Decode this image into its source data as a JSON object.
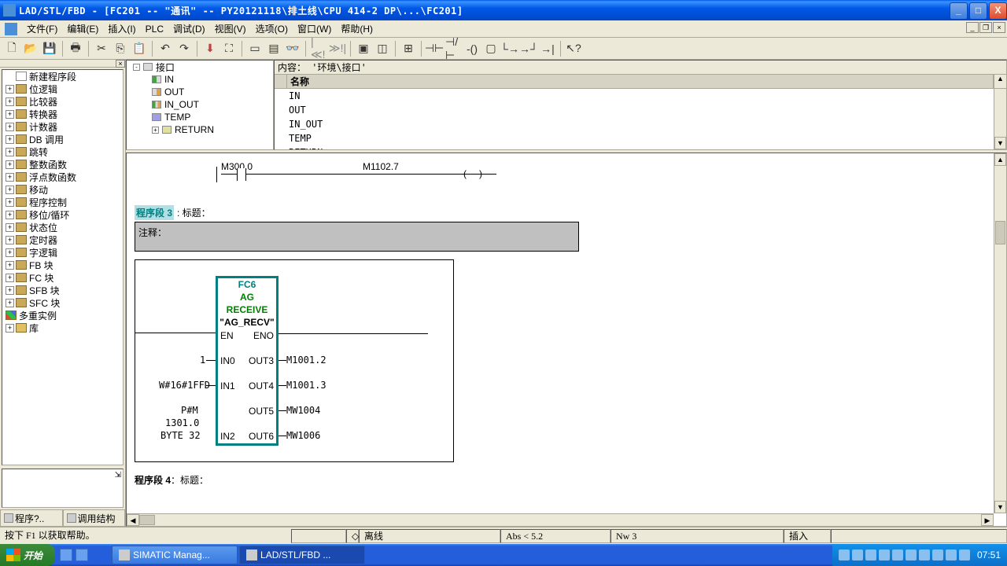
{
  "titlebar": {
    "title": "LAD/STL/FBD  - [FC201 -- \"通讯\" -- PY20121118\\排土线\\CPU 414-2 DP\\...\\FC201]"
  },
  "menu": {
    "file": "文件(F)",
    "edit": "编辑(E)",
    "insert": "插入(I)",
    "plc": "PLC",
    "debug": "调试(D)",
    "view": "视图(V)",
    "options": "选项(O)",
    "window": "窗口(W)",
    "help": "帮助(H)"
  },
  "sidebar": {
    "catalog": [
      "新建程序段",
      "位逻辑",
      "比较器",
      "转换器",
      "计数器",
      "DB 调用",
      "跳转",
      "整数函数",
      "浮点数函数",
      "移动",
      "程序控制",
      "移位/循环",
      "状态位",
      "定时器",
      "字逻辑",
      "FB 块",
      "FC 块",
      "SFB 块",
      "SFC 块",
      "多重实例",
      "库"
    ],
    "tabs": {
      "catalog": "程序?..",
      "callstruct": "调用结构"
    }
  },
  "interface": {
    "path": "内容：  '环境\\接口'",
    "root": "接口",
    "params": [
      "IN",
      "OUT",
      "IN_OUT",
      "TEMP",
      "RETURN"
    ],
    "name_header": "名称",
    "list": [
      "IN",
      "OUT",
      "IN_OUT",
      "TEMP",
      "RETURN"
    ]
  },
  "code": {
    "net1": {
      "contact": "M300.0",
      "coil": "M1102.7"
    },
    "net3": {
      "label": "程序段 3",
      "title_sep": ": 标题：",
      "comment_label": "注释：",
      "block": {
        "fc": "FC6",
        "name1": "AG",
        "name2": "RECEIVE",
        "symbol": "\"AG_RECV\"",
        "en": "EN",
        "eno": "ENO",
        "in0": "IN0",
        "out3": "OUT3",
        "in1": "IN1",
        "out4": "OUT4",
        "out5": "OUT5",
        "in2": "IN2",
        "out6": "OUT6"
      },
      "inputs": {
        "in0": "1",
        "in1": "W#16#1FFD",
        "in2_l1": "P#M",
        "in2_l2": "1301.0",
        "in2_l3": "BYTE 32"
      },
      "outputs": {
        "out3": "M1001.2",
        "out4": "M1001.3",
        "out5": "MW1004",
        "out6": "MW1006"
      }
    },
    "net4": {
      "label": "程序段 4",
      "title_sep": "：标题："
    }
  },
  "status": {
    "help": "按下 F1 以获取帮助。",
    "offline": "离线",
    "abs": "Abs < 5.2",
    "nw": "Nw 3",
    "insert": "插入"
  },
  "taskbar": {
    "start": "开始",
    "tasks": [
      {
        "label": "SIMATIC Manag...",
        "active": false
      },
      {
        "label": "LAD/STL/FBD  ...",
        "active": true
      }
    ],
    "clock": "07:51"
  }
}
